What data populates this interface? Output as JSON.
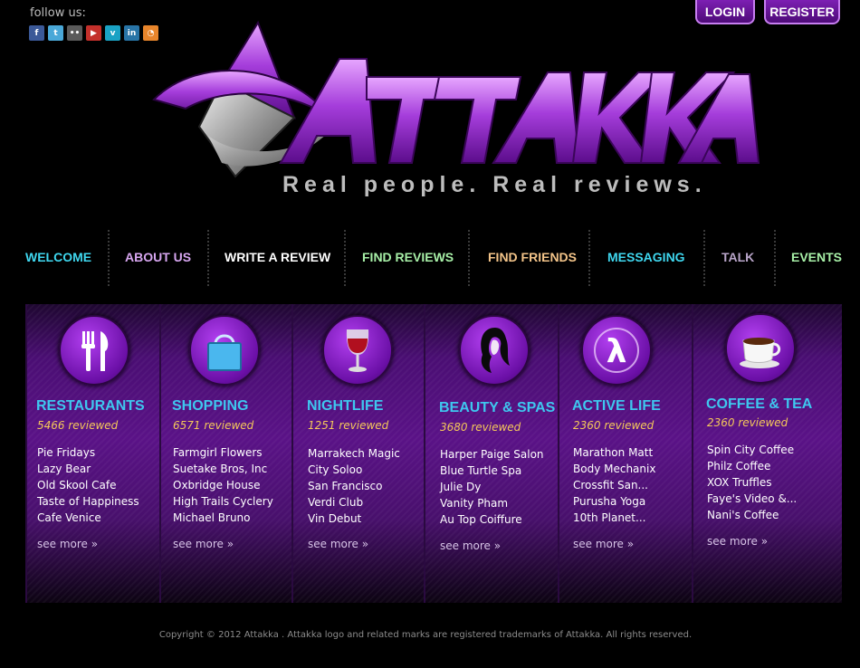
{
  "header": {
    "follow_label": "follow us:",
    "social": [
      {
        "icon": "facebook-icon",
        "glyph": "f",
        "color": "#3b5998"
      },
      {
        "icon": "twitter-icon",
        "glyph": "t",
        "color": "#4aa8d8"
      },
      {
        "icon": "flickr-icon",
        "glyph": "••",
        "color": "#5a5a5a"
      },
      {
        "icon": "youtube-icon",
        "glyph": "▶",
        "color": "#c4302b"
      },
      {
        "icon": "vimeo-icon",
        "glyph": "v",
        "color": "#1aa2c4"
      },
      {
        "icon": "linkedin-icon",
        "glyph": "in",
        "color": "#2874a6"
      },
      {
        "icon": "rss-icon",
        "glyph": "◔",
        "color": "#e8852b"
      }
    ],
    "login_label": "LOGIN",
    "register_label": "REGISTER",
    "tagline": "Real people. Real reviews."
  },
  "brand": {
    "logo_text": "ATTAKKA",
    "accent": "#9b2fd6"
  },
  "nav": [
    {
      "label": "WELCOME",
      "color": "#3fd7ef"
    },
    {
      "label": "ABOUT US",
      "color": "#d7a6f0"
    },
    {
      "label": "WRITE A REVIEW",
      "color": "#ffffff"
    },
    {
      "label": "FIND REVIEWS",
      "color": "#a7f0a7"
    },
    {
      "label": "FIND FRIENDS",
      "color": "#f3c489"
    },
    {
      "label": "MESSAGING",
      "color": "#3fd7ef"
    },
    {
      "label": "TALK",
      "color": "#b9a5c9"
    },
    {
      "label": "EVENTS",
      "color": "#a7f0a7"
    }
  ],
  "categories": [
    {
      "name": "RESTAURANTS",
      "icon": "fork-knife-icon",
      "reviewed": "5466 reviewed",
      "places": [
        "Pie Fridays",
        "Lazy Bear",
        "Old Skool Cafe",
        "Taste of Happiness",
        "Cafe Venice"
      ],
      "more": "see more »"
    },
    {
      "name": "SHOPPING",
      "icon": "shopping-bag-icon",
      "reviewed": "6571 reviewed",
      "places": [
        "Farmgirl Flowers",
        "Suetake Bros, Inc",
        "Oxbridge House",
        "High Trails Cyclery",
        "Michael Bruno"
      ],
      "more": "see more »"
    },
    {
      "name": "NIGHTLIFE",
      "icon": "wine-glass-icon",
      "reviewed": "1251 reviewed",
      "places": [
        "Marrakech Magic",
        "City Soloo",
        "San Francisco",
        "Verdi Club",
        "Vin Debut"
      ],
      "more": "see more »"
    },
    {
      "name": "BEAUTY & SPAS",
      "icon": "woman-silhouette-icon",
      "reviewed": "3680 reviewed",
      "places": [
        "Harper Paige Salon",
        "Blue Turtle Spa",
        "Julie Dy",
        "Vanity Pham",
        "Au Top Coiffure"
      ],
      "more": "see more »"
    },
    {
      "name": "ACTIVE LIFE",
      "icon": "lambda-icon",
      "reviewed": "2360 reviewed",
      "places": [
        "Marathon Matt",
        "Body Mechanix",
        "Crossfit San...",
        "Purusha Yoga",
        "10th Planet..."
      ],
      "more": "see more »"
    },
    {
      "name": "COFFEE & TEA",
      "icon": "coffee-cup-icon",
      "reviewed": "2360 reviewed",
      "places": [
        "Spin City Coffee",
        "Philz Coffee",
        "XOX Truffles",
        "Faye's Video &...",
        "Nani's Coffee"
      ],
      "more": "see more »"
    }
  ],
  "footer": {
    "copyright": "Copyright © 2012 Attakka . Attakka logo and related marks are registered trademarks of Attakka. All rights reserved."
  }
}
